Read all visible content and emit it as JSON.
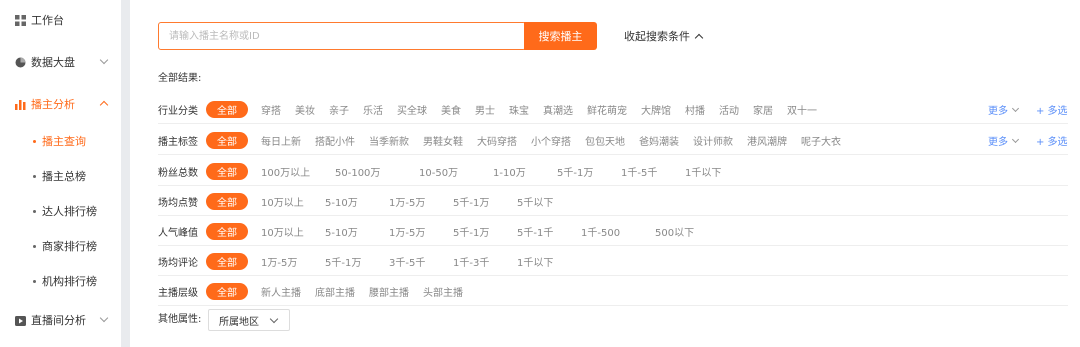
{
  "sidebar": {
    "items": [
      {
        "label": "工作台",
        "icon": "grid-icon"
      },
      {
        "label": "数据大盘",
        "icon": "pie-chart-icon"
      },
      {
        "label": "播主分析",
        "icon": "bar-chart-icon"
      },
      {
        "label": "直播间分析",
        "icon": "play-icon"
      }
    ],
    "subitems": [
      "播主查询",
      "播主总榜",
      "达人排行榜",
      "商家排行榜",
      "机构排行榜"
    ]
  },
  "search": {
    "placeholder": "请输入播主名称或ID",
    "button": "搜索播主",
    "collapse": "收起搜索条件"
  },
  "all_results": "全部结果:",
  "all_label": "全部",
  "more_label": "更多",
  "multi_label": "+ 多选",
  "filters": [
    {
      "label": "行业分类",
      "options": [
        "穿搭",
        "美妆",
        "亲子",
        "乐活",
        "买全球",
        "美食",
        "男士",
        "珠宝",
        "真潮选",
        "鲜花萌宠",
        "大牌馆",
        "村播",
        "活动",
        "家居",
        "双十一"
      ]
    },
    {
      "label": "播主标签",
      "options": [
        "每日上新",
        "搭配小件",
        "当季新款",
        "男鞋女鞋",
        "大码穿搭",
        "小个穿搭",
        "包包天地",
        "爸妈潮装",
        "设计师款",
        "港风潮牌",
        "呢子大衣"
      ]
    },
    {
      "label": "粉丝总数",
      "options": [
        "100万以上",
        "50-100万",
        "10-50万",
        "1-10万",
        "5千-1万",
        "1千-5千",
        "1千以下"
      ]
    },
    {
      "label": "场均点赞",
      "options": [
        "10万以上",
        "5-10万",
        "1万-5万",
        "5千-1万",
        "5千以下"
      ]
    },
    {
      "label": "人气峰值",
      "options": [
        "10万以上",
        "5-10万",
        "1万-5万",
        "5千-1万",
        "5千-1千",
        "1千-500",
        "500以下"
      ]
    },
    {
      "label": "场均评论",
      "options": [
        "1万-5万",
        "5千-1万",
        "3千-5千",
        "1千-3千",
        "1千以下"
      ]
    },
    {
      "label": "主播层级",
      "options": [
        "新人主播",
        "底部主播",
        "腰部主播",
        "头部主播"
      ]
    }
  ],
  "other": {
    "label": "其他属性:",
    "region": "所属地区"
  },
  "colors": {
    "accent": "#ff6a1a",
    "link": "#5b8ff9"
  }
}
